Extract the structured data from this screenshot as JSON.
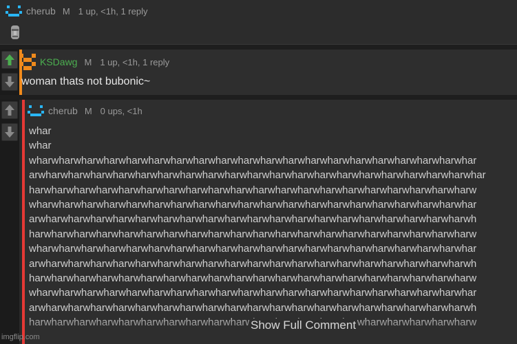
{
  "comments": [
    {
      "username": "cherub",
      "gender": "M",
      "meta": "1 up, <1h, 1 reply",
      "avatar_icon": "cyan-smiley-icon",
      "body_icon": "moai-emoji-icon",
      "name_color": "#9a9a9a"
    },
    {
      "username": "KSDawg",
      "gender": "M",
      "meta": "1 up, <1h, 1 reply",
      "avatar_icon": "orange-pixel-avatar-icon",
      "body": "woman thats not bubonic~",
      "name_color": "#4caf50",
      "bar_color": "#f08a1c"
    },
    {
      "username": "cherub",
      "gender": "M",
      "meta": "0 ups, <1h",
      "avatar_icon": "cyan-smiley-icon",
      "body_lines": [
        "whar",
        "whar",
        "wharwharwharwharwharwharwharwharwharwharwharwharwharwharwharwharwharwharwharwhar",
        "arwharwharwharwharwharwharwharwharwharwharwharwharwharwharwharwharwharwharwharwhar",
        "harwharwharwharwharwharwharwharwharwharwharwharwharwharwharwharwharwharwharwharw",
        "wharwharwharwharwharwharwharwharwharwharwharwharwharwharwharwharwharwharwharwhar",
        "arwharwharwharwharwharwharwharwharwharwharwharwharwharwharwharwharwharwharwharwh",
        "harwharwharwharwharwharwharwharwharwharwharwharwharwharwharwharwharwharwharwharw",
        "wharwharwharwharwharwharwharwharwharwharwharwharwharwharwharwharwharwharwharwhar",
        "arwharwharwharwharwharwharwharwharwharwharwharwharwharwharwharwharwharwharwharwh",
        "harwharwharwharwharwharwharwharwharwharwharwharwharwharwharwharwharwharwharwharw",
        "wharwharwharwharwharwharwharwharwharwharwharwharwharwharwharwharwharwharwharwhar",
        "arwharwharwharwharwharwharwharwharwharwharwharwharwharwharwharwharwharwharwharwh",
        "harwharwharwharwharwharwharwharwharwharwharwharwharwharwharwharwharwharwharwharw"
      ],
      "show_full": "Show Full Comment",
      "bar_color": "#e53935"
    }
  ],
  "watermark": "imgflip.com",
  "colors": {
    "upvote_active": "#4caf50",
    "vote_inactive": "#8a8a8a",
    "background": "#1e1e1e",
    "panel": "#2e2e2e"
  }
}
